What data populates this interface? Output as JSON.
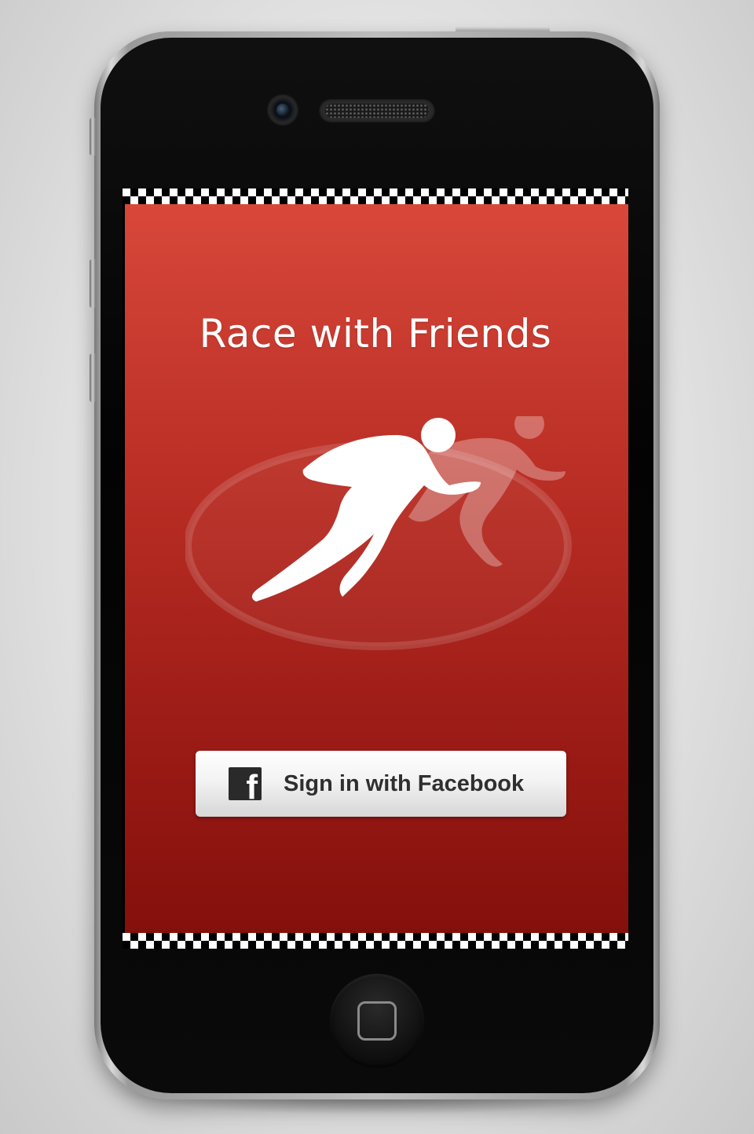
{
  "app": {
    "title": "Race with Friends"
  },
  "logo": {
    "icon": "runner-icon",
    "description_color": "#ffffff"
  },
  "login": {
    "facebook_button_label": "Sign in with Facebook",
    "facebook_icon": "facebook-icon",
    "facebook_icon_glyph": "f"
  },
  "device": {
    "home_button_icon": "home-square-icon"
  },
  "colors": {
    "background_top": "#d8473a",
    "background_bottom": "#84100c",
    "title_text": "#ffffff",
    "button_text": "#2f2f2f",
    "facebook_icon_bg": "#2a2a2a"
  }
}
